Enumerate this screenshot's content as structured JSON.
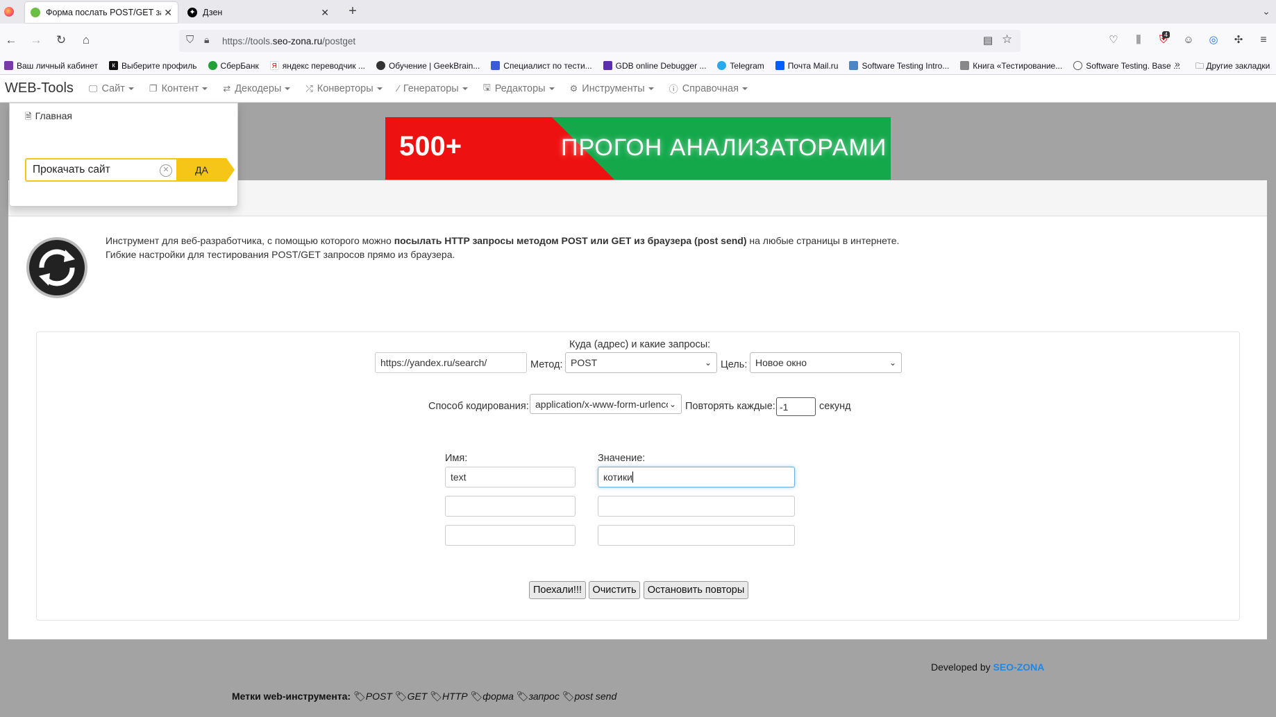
{
  "browser": {
    "tabs": [
      {
        "title": "Форма послать POST/GET запрос"
      },
      {
        "title": "Дзен"
      }
    ],
    "url_prefix": "https://tools.",
    "url_domain": "seo-zona.ru",
    "url_path": "/postget",
    "badge_count": "4",
    "bookmarks": [
      "Ваш личный кабинет",
      "Выберите профиль",
      "СберБанк",
      "яндекс переводчик ...",
      "Обучение | GeekBrain...",
      "Специалист по тести...",
      "GDB online Debugger ...",
      "Telegram",
      "Почта Mail.ru",
      "Software Testing Intro...",
      "Книга «Тестирование...",
      "Software Testing. Base ..."
    ],
    "other_bookmarks": "Другие закладки"
  },
  "nav": {
    "brand": "WEB-Tools",
    "items": [
      {
        "label": "Сайт"
      },
      {
        "label": "Контент"
      },
      {
        "label": "Декодеры"
      },
      {
        "label": "Конверторы"
      },
      {
        "label": "Генераторы"
      },
      {
        "label": "Редакторы"
      },
      {
        "label": "Инструменты"
      },
      {
        "label": "Справочная"
      }
    ]
  },
  "dropdown": {
    "home": "Главная",
    "promo_input": "Прокачать сайт",
    "promo_button": "ДА"
  },
  "banner": {
    "left": "500+",
    "right": "ПРОГОН АНАЛИЗАТОРАМИ"
  },
  "description": {
    "part1": "Инструмент для веб-разработчика, с помощью которого можно ",
    "bold": "посылать HTTP запросы методом POST или GET из браузера (post send)",
    "part2": " на любые страницы в интернете.",
    "line2": "Гибкие настройки для тестирования POST/GET запросов прямо из браузера."
  },
  "form": {
    "where_label": "Куда (адрес) и какие запросы:",
    "url_value": "https://yandex.ru/search/",
    "method_label": "Метод:",
    "method_value": "POST",
    "target_label": "Цель:",
    "target_value": "Новое окно",
    "encoding_label": "Способ кодирования:",
    "encoding_value": "application/x-www-form-urlenco",
    "repeat_label": "Повторять каждые:",
    "repeat_value": "-1",
    "seconds_label": "секунд",
    "name_header": "Имя:",
    "value_header": "Значение:",
    "rows": [
      {
        "name": "text",
        "value": "котики"
      },
      {
        "name": "",
        "value": ""
      },
      {
        "name": "",
        "value": ""
      }
    ],
    "submit_button": "Поехали!!!",
    "clear_button": "Очистить",
    "stop_button": "Остановить повторы"
  },
  "footer": {
    "developed_by": "Developed by",
    "developer": "SEO-ZONA",
    "tags_label": "Метки web-инструмента:",
    "tags": [
      "POST",
      "GET",
      "HTTP",
      "форма",
      "запрос",
      "post send"
    ]
  }
}
